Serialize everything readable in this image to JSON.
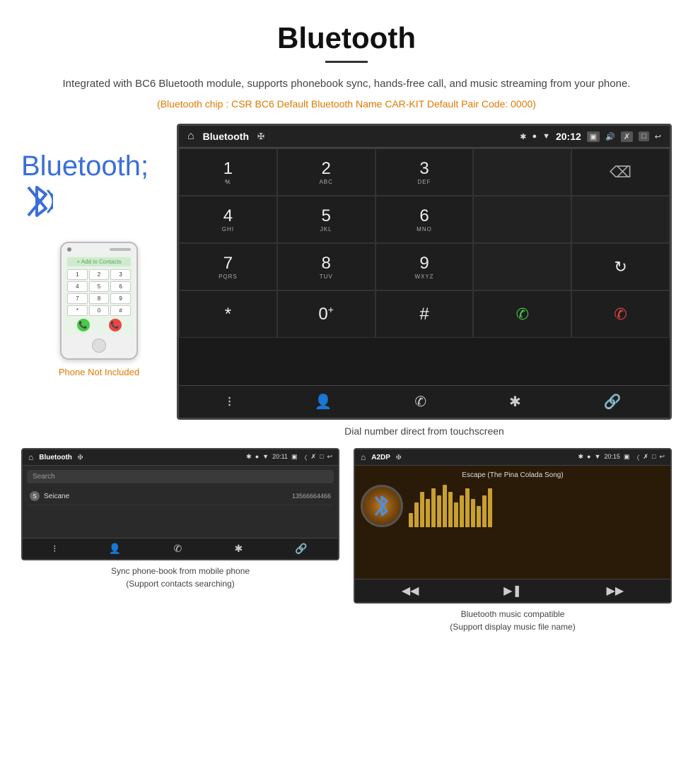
{
  "page": {
    "title": "Bluetooth",
    "subtitle": "Integrated with BC6 Bluetooth module, supports phonebook sync, hands-free call, and music streaming from your phone.",
    "bluetooth_info": "(Bluetooth chip : CSR BC6    Default Bluetooth Name CAR-KIT    Default Pair Code: 0000)",
    "dial_caption": "Dial number direct from touchscreen",
    "phone_not_included": "Phone Not Included",
    "phonebook_caption": "Sync phone-book from mobile phone\n(Support contacts searching)",
    "music_caption": "Bluetooth music compatible\n(Support display music file name)"
  },
  "car_screen": {
    "title": "Bluetooth",
    "time": "20:12",
    "dialpad": [
      {
        "num": "1",
        "sub": "⌐"
      },
      {
        "num": "2",
        "sub": "ABC"
      },
      {
        "num": "3",
        "sub": "DEF"
      },
      {
        "num": "",
        "sub": ""
      },
      {
        "num": "⌫",
        "sub": ""
      },
      {
        "num": "4",
        "sub": "GHI"
      },
      {
        "num": "5",
        "sub": "JKL"
      },
      {
        "num": "6",
        "sub": "MNO"
      },
      {
        "num": "",
        "sub": ""
      },
      {
        "num": "",
        "sub": ""
      },
      {
        "num": "7",
        "sub": "PQRS"
      },
      {
        "num": "8",
        "sub": "TUV"
      },
      {
        "num": "9",
        "sub": "WXYZ"
      },
      {
        "num": "",
        "sub": ""
      },
      {
        "num": "↻",
        "sub": ""
      },
      {
        "num": "*",
        "sub": ""
      },
      {
        "num": "0+",
        "sub": ""
      },
      {
        "num": "#",
        "sub": ""
      },
      {
        "num": "📞",
        "sub": "green"
      },
      {
        "num": "📵",
        "sub": "red"
      }
    ],
    "nav_icons": [
      "⊞",
      "👤",
      "📞",
      "✱",
      "🔗"
    ]
  },
  "phonebook_screen": {
    "title": "Bluetooth",
    "time": "20:11",
    "search_placeholder": "Search",
    "contacts": [
      {
        "letter": "S",
        "name": "Seicane",
        "phone": "13566664466"
      }
    ]
  },
  "music_screen": {
    "title": "A2DP",
    "time": "20:15",
    "song_title": "Escape (The Pina Colada Song)",
    "eq_bars": [
      20,
      35,
      50,
      40,
      55,
      45,
      60,
      50,
      35,
      45,
      55,
      40,
      30,
      45,
      55
    ]
  }
}
